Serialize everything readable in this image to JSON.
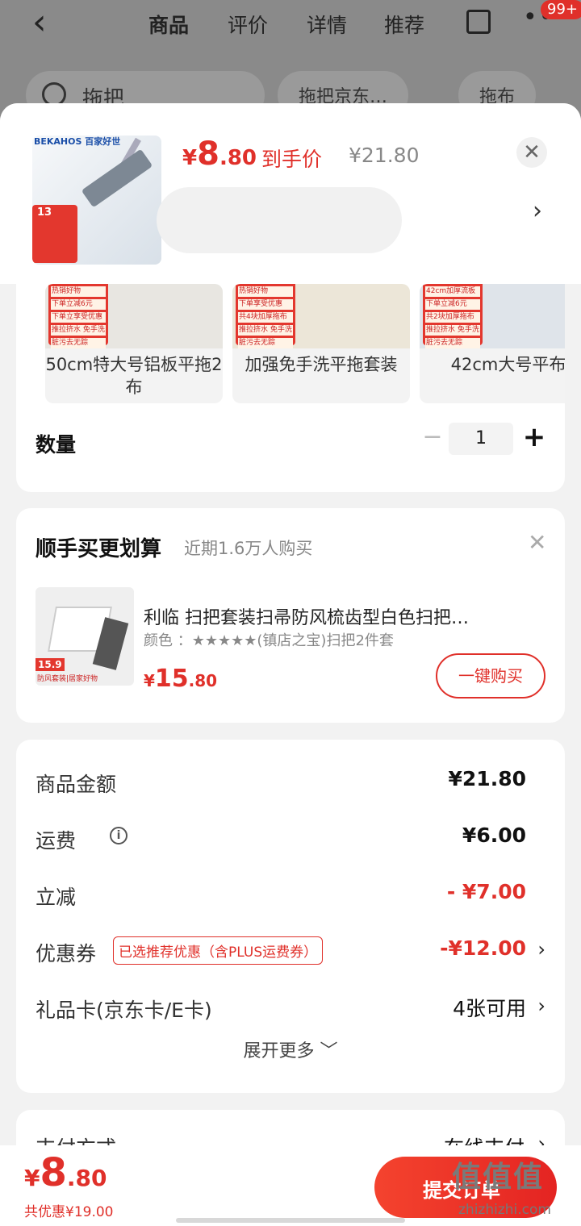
{
  "nav": {
    "tabs": [
      "商品",
      "评价",
      "详情",
      "推荐"
    ],
    "badge": "99+"
  },
  "search": {
    "text": "拖把"
  },
  "chips": [
    "拖把京东…",
    "拖布"
  ],
  "product": {
    "brand_logo": "BEKAHOS 百家好世",
    "promo_number": "13",
    "price_currency": "¥",
    "price_int": "8",
    "price_dec": ".80",
    "price_label": "到手价",
    "original_price": "¥21.80"
  },
  "variants": [
    {
      "label": "50cm特大号铝板平拖2布",
      "tags": [
        "热销好物",
        "下单立减6元",
        "下单立享受优惠",
        "推拉挤水 免手洗",
        "脏污去无踪"
      ]
    },
    {
      "label": "加强免手洗平拖套装",
      "tags": [
        "热销好物",
        "下单享受优惠",
        "共4块加厚拖布",
        "推拉挤水 免手洗",
        "脏污去无踪"
      ]
    },
    {
      "label": "42cm大号平布",
      "tags": [
        "42cm加厚流板",
        "下单立减6元",
        "共2块加厚拖布",
        "推拉挤水 免手洗",
        "脏污去无踪"
      ]
    }
  ],
  "quantity": {
    "label": "数量",
    "value": "1",
    "minus": "−",
    "plus": "+"
  },
  "bundle": {
    "title": "顺手买更划算",
    "subtitle": "近期1.6万人购买",
    "name": "利临 扫把套装扫帚防风梳齿型白色扫把…",
    "spec": "颜色 ：★★★★★(镇店之宝)扫把2件套",
    "img_label": "15.9",
    "img_label2": "防风套装|居家好物",
    "price_currency": "¥",
    "price_int": "15",
    "price_dec": ".80",
    "buy_label": "一键购买"
  },
  "summary": {
    "rows": [
      {
        "label": "商品金额",
        "value": "¥21.80"
      },
      {
        "label": "运费",
        "value": "¥6.00"
      },
      {
        "label": "立减",
        "value": "- ¥7.00"
      },
      {
        "label": "优惠券",
        "tag": "已选推荐优惠（含PLUS运费券）",
        "value": "-¥12.00"
      },
      {
        "label": "礼品卡(京东卡/E卡)",
        "value": "4张可用"
      }
    ],
    "expand": "展开更多 ﹀"
  },
  "payment": {
    "label": "支付方式",
    "value": "在线支付"
  },
  "bottom": {
    "price_currency": "¥",
    "price_int": "8",
    "price_dec": ".80",
    "savings": "共优惠¥19.00",
    "submit": "提交订单"
  },
  "watermark": {
    "text": "值值值",
    "domain": "zhizhizhi.com"
  },
  "colors": {
    "accent": "#e0302a",
    "bg": "#f2f2f2"
  }
}
